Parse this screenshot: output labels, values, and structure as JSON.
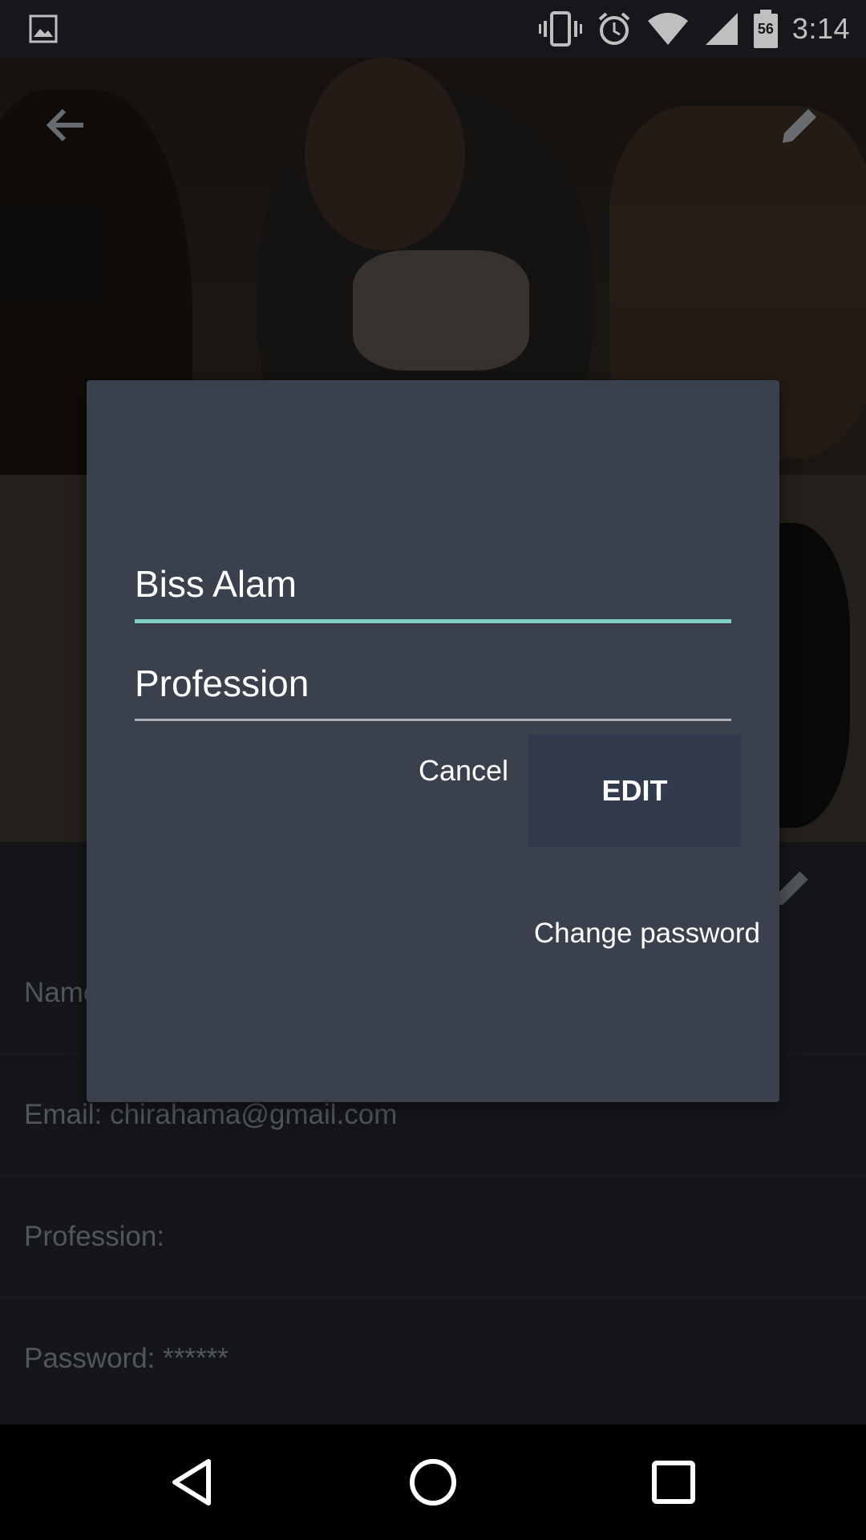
{
  "status_bar": {
    "time": "3:14",
    "battery_level": "56",
    "icons": [
      "image-icon",
      "vibrate-icon",
      "alarm-icon",
      "wifi-icon",
      "signal-icon",
      "battery-icon"
    ]
  },
  "app_bar": {
    "back_icon": "arrow-back-icon",
    "edit_icon": "pencil-icon"
  },
  "profile": {
    "fields": [
      {
        "label": "Name:"
      },
      {
        "label": "Email: chirahama@gmail.com"
      },
      {
        "label": "Profession:"
      },
      {
        "label": "Password: ******"
      }
    ]
  },
  "dialog": {
    "name_value": "Biss Alam",
    "profession_placeholder": "Profession",
    "cancel_label": "Cancel",
    "edit_label": "EDIT",
    "change_password_label": "Change password"
  },
  "colors": {
    "dialog_bg": "#3a414d",
    "accent_underline": "#7fd1c3",
    "edit_button_bg": "#313b4d"
  },
  "nav_bar": {
    "icons": [
      "back-triangle-icon",
      "home-circle-icon",
      "recents-square-icon"
    ]
  }
}
